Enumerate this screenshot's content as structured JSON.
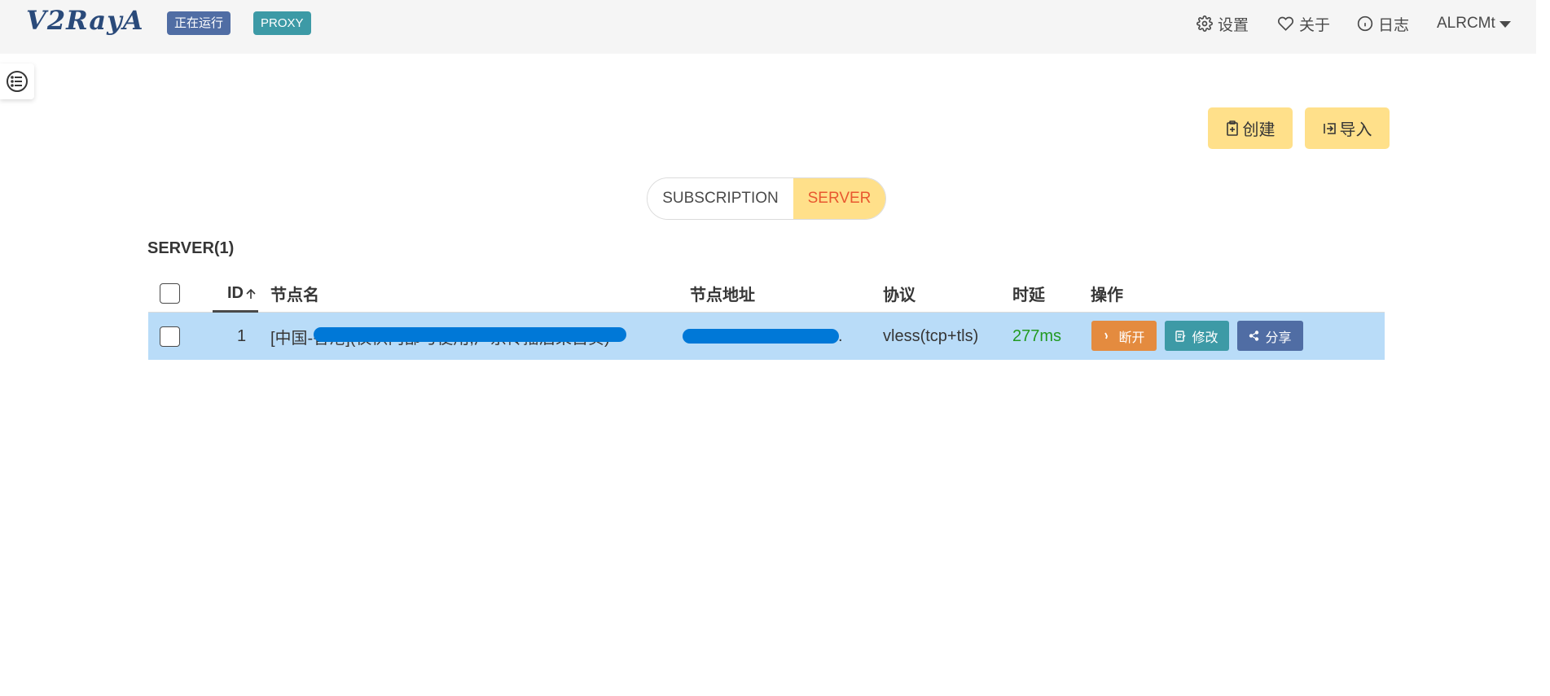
{
  "navbar": {
    "logo": "V2RayA",
    "status_badge": "正在运行",
    "mode_badge": "PROXY",
    "settings": "设置",
    "about": "关于",
    "log": "日志",
    "user": "ALRCMt"
  },
  "actions": {
    "create": "创建",
    "import": "导入"
  },
  "tabs": {
    "subscription": "SUBSCRIPTION",
    "server": "SERVER",
    "active": "server"
  },
  "section": {
    "title": "SERVER(1)"
  },
  "table": {
    "columns": {
      "id": "ID",
      "name": "节点名",
      "address": "节点地址",
      "protocol": "协议",
      "latency": "时延",
      "operations": "操作"
    },
    "rows": [
      {
        "id": "1",
        "name": "[中国-香港](仅供内部与使用,广京传播后果自负)",
        "address": ".",
        "protocol": "vless(tcp+tls)",
        "latency": "277ms",
        "disconnect": "断开",
        "edit": "修改",
        "share": "分享"
      }
    ]
  },
  "colors": {
    "running_badge": "#506da4",
    "proxy_badge": "#3d9aa6",
    "warning": "#ffe08a",
    "active_tab_text": "#e8582f",
    "selected_row": "#b9dcf8",
    "latency_good": "#229a22",
    "disconnect": "#e48b3f",
    "edit": "#3d9aa6",
    "share": "#506da4"
  }
}
